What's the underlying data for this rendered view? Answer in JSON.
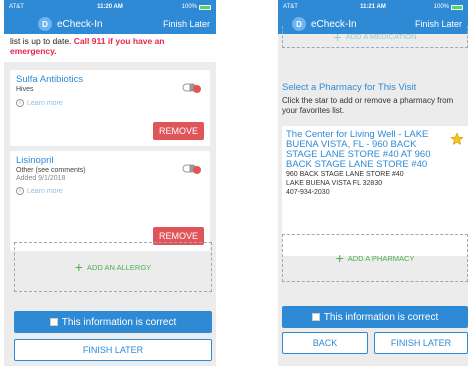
{
  "screen1": {
    "status": {
      "carrier": "AT&T",
      "time": "11:20 AM",
      "battery": "100%"
    },
    "nav": {
      "avatar_letter": "D",
      "title": "eCheck-In",
      "action": "Finish Later"
    },
    "intro_text": "list is up to date.",
    "intro_warning": "Call 911 if you have an emergency.",
    "allergies": [
      {
        "name": "Sulfa Antibiotics",
        "reaction": "Hives",
        "date": "",
        "learn": "Learn more",
        "remove": "REMOVE"
      },
      {
        "name": "Lisinopril",
        "reaction": "Other (see comments)",
        "date": "Added 9/1/2018",
        "learn": "Learn more",
        "remove": "REMOVE"
      }
    ],
    "add_allergy": "ADD AN ALLERGY",
    "correct_label": "This information is correct",
    "finish_later": "FINISH LATER"
  },
  "screen2": {
    "status": {
      "carrier": "AT&T",
      "time": "11:21 AM",
      "battery": "100%"
    },
    "nav": {
      "avatar_letter": "D",
      "title": "eCheck-In",
      "action": "Finish Later"
    },
    "add_medication": "ADD A MEDICATION",
    "section_title": "Select a Pharmacy for This Visit",
    "section_sub": "Click the star to add or remove a pharmacy from your favorites list.",
    "pharmacy": {
      "name": "The Center for Living Well - LAKE BUENA VISTA, FL - 960 BACK STAGE LANE STORE #40 AT 960 BACK STAGE LANE STORE #40",
      "addr1": "960 BACK STAGE LANE STORE #40",
      "addr2": "LAKE BUENA VISTA FL 32830",
      "phone": "407-934-2030"
    },
    "add_pharmacy": "ADD A PHARMACY",
    "correct_label": "This information is correct",
    "back": "BACK",
    "finish_later": "FINISH LATER"
  },
  "colors": {
    "primary": "#2f8ad6",
    "remove": "#e0555a",
    "warning": "#e3284a",
    "add": "#4caf50",
    "star": "#f5c518"
  },
  "icons": [
    "pill-icon",
    "info-icon",
    "plus-icon",
    "star-icon",
    "battery-icon"
  ]
}
